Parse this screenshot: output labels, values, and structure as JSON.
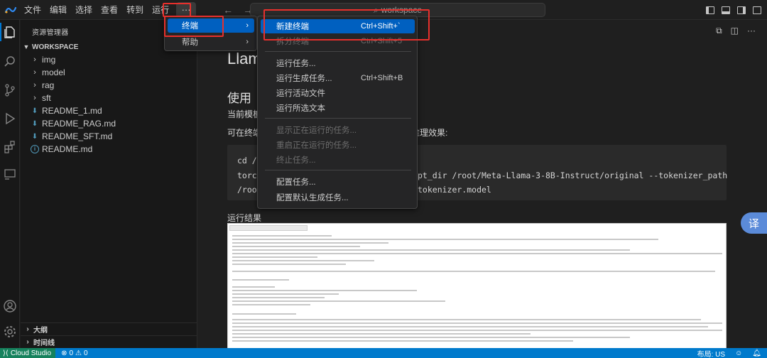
{
  "menubar": {
    "items": [
      "文件",
      "编辑",
      "选择",
      "查看",
      "转到",
      "运行"
    ],
    "more_label": "···"
  },
  "search": {
    "text": "workspace"
  },
  "sidebar": {
    "title": "资源管理器",
    "workspace": "WORKSPACE",
    "folders": [
      "img",
      "model",
      "rag",
      "sft"
    ],
    "files": [
      "README_1.md",
      "README_RAG.md",
      "README_SFT.md",
      "README.md"
    ],
    "sections": [
      "大纲",
      "时间线"
    ]
  },
  "editor": {
    "h1": "Llam",
    "h2": "使用",
    "p1": "当前模板",
    "p2_head": "可在终端",
    "p2_tail": "推理效果:",
    "code": {
      "line1": "cd /r",
      "line2_head": "torch",
      "line2_tail": "pt_dir /root/Meta-Llama-3-8B-Instruct/original --tokenizer_path",
      "line3_head": "/root",
      "line3_tail": "tokenizer.model"
    },
    "p3": "运行结果",
    "translate_fab": "译"
  },
  "menu_more": {
    "items": [
      {
        "label": "终端",
        "arrow": "›"
      },
      {
        "label": "帮助",
        "arrow": "›"
      }
    ]
  },
  "terminal_menu": {
    "items": [
      {
        "label": "新建终端",
        "kb": "Ctrl+Shift+`"
      },
      {
        "label": "拆分终端",
        "kb": "Ctrl+Shift+5"
      },
      {
        "label": "运行任务...",
        "kb": ""
      },
      {
        "label": "运行生成任务...",
        "kb": "Ctrl+Shift+B"
      },
      {
        "label": "运行活动文件",
        "kb": ""
      },
      {
        "label": "运行所选文本",
        "kb": ""
      },
      {
        "label": "显示正在运行的任务...",
        "kb": ""
      },
      {
        "label": "重启正在运行的任务...",
        "kb": ""
      },
      {
        "label": "终止任务...",
        "kb": ""
      },
      {
        "label": "配置任务...",
        "kb": ""
      },
      {
        "label": "配置默认生成任务...",
        "kb": ""
      }
    ]
  },
  "statusbar": {
    "remote": "Cloud Studio",
    "errors": "0",
    "warnings": "0",
    "layout": "布局: US"
  },
  "colors": {
    "accent": "#0078d4",
    "statusbar": "#007acc",
    "highlight": "#0060c0",
    "annotation": "#e8302c"
  }
}
